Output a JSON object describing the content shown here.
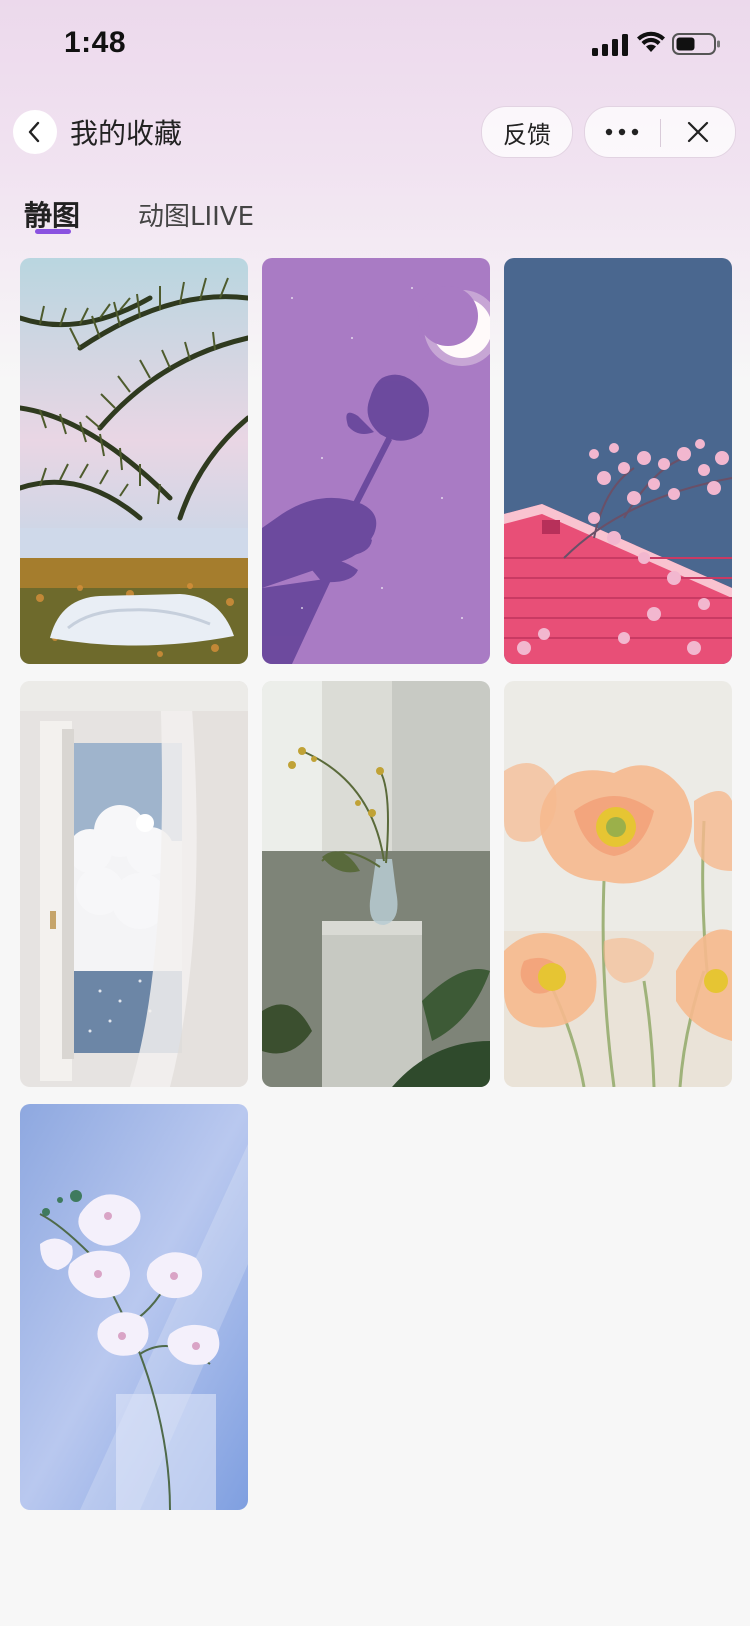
{
  "status_bar": {
    "time": "1:48"
  },
  "nav": {
    "title": "我的收藏",
    "feedback_label": "反馈"
  },
  "tabs": [
    {
      "label": "静图",
      "active": true
    },
    {
      "label": "动图LIIVE",
      "active": false
    }
  ],
  "accent_color": "#8a52e0",
  "wallpapers": [
    {
      "name": "palm-beach-bed"
    },
    {
      "name": "purple-rose-moon"
    },
    {
      "name": "pink-house-blossom"
    },
    {
      "name": "window-clouds-sea"
    },
    {
      "name": "vase-shadow"
    },
    {
      "name": "peach-poppies"
    },
    {
      "name": "white-orchid"
    }
  ]
}
